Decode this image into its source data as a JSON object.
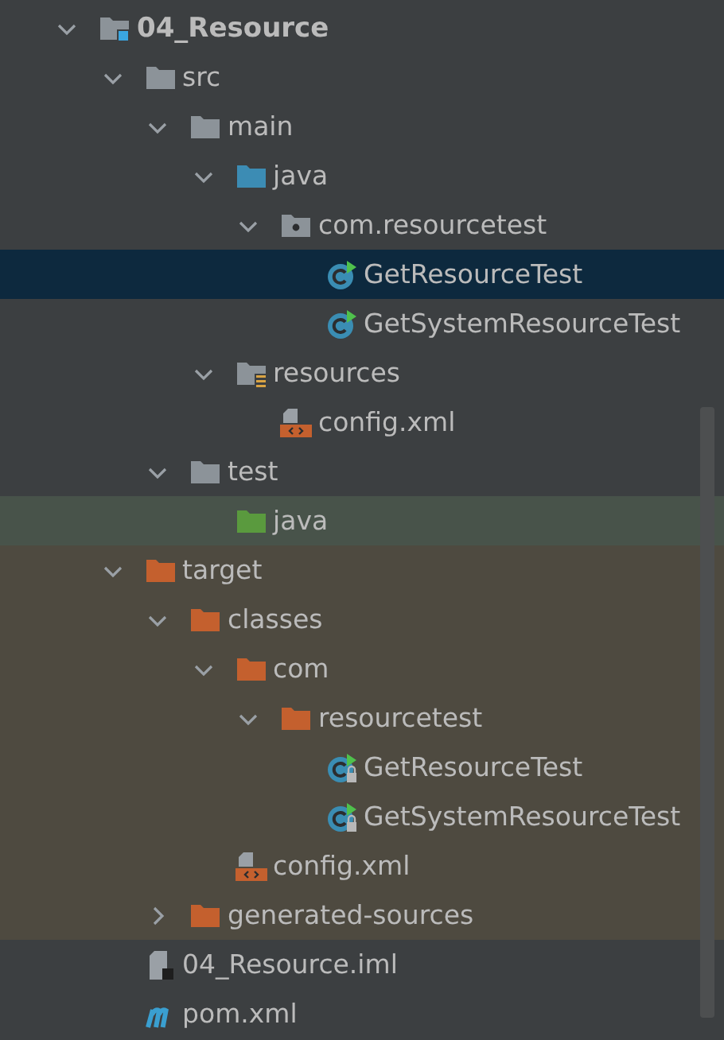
{
  "project_tree": [
    {
      "name": "04_Resource",
      "kind": "module",
      "expanded": true,
      "selected": false,
      "children": [
        {
          "name": "src",
          "kind": "folder",
          "expanded": true,
          "selected": false,
          "children": [
            {
              "name": "main",
              "kind": "folder",
              "expanded": true,
              "selected": false,
              "children": [
                {
                  "name": "java",
                  "kind": "source-folder",
                  "expanded": true,
                  "selected": false,
                  "children": [
                    {
                      "name": "com.resourcetest",
                      "kind": "package",
                      "expanded": true,
                      "selected": false,
                      "children": [
                        {
                          "name": "GetResourceTest",
                          "kind": "class",
                          "readonly": false,
                          "selected": true
                        },
                        {
                          "name": "GetSystemResourceTest",
                          "kind": "class",
                          "readonly": false,
                          "selected": false
                        }
                      ]
                    }
                  ]
                },
                {
                  "name": "resources",
                  "kind": "resources",
                  "expanded": true,
                  "selected": false,
                  "children": [
                    {
                      "name": "config.xml",
                      "kind": "xml",
                      "selected": false
                    }
                  ]
                }
              ]
            },
            {
              "name": "test",
              "kind": "folder",
              "expanded": true,
              "selected": false,
              "children": [
                {
                  "name": "java",
                  "kind": "test-folder",
                  "selected": false
                }
              ]
            }
          ]
        },
        {
          "name": "target",
          "kind": "excluded-folder",
          "expanded": true,
          "selected": false,
          "children": [
            {
              "name": "classes",
              "kind": "excluded-folder",
              "expanded": true,
              "selected": false,
              "children": [
                {
                  "name": "com",
                  "kind": "excluded-folder",
                  "expanded": true,
                  "selected": false,
                  "children": [
                    {
                      "name": "resourcetest",
                      "kind": "excluded-folder",
                      "expanded": true,
                      "selected": false,
                      "children": [
                        {
                          "name": "GetResourceTest",
                          "kind": "class",
                          "readonly": true,
                          "selected": false
                        },
                        {
                          "name": "GetSystemResourceTest",
                          "kind": "class",
                          "readonly": true,
                          "selected": false
                        }
                      ]
                    }
                  ]
                },
                {
                  "name": "config.xml",
                  "kind": "xml",
                  "selected": false
                }
              ]
            },
            {
              "name": "generated-sources",
              "kind": "excluded-folder",
              "expanded": false,
              "selected": false
            }
          ]
        },
        {
          "name": "04_Resource.iml",
          "kind": "iml",
          "selected": false
        },
        {
          "name": "pom.xml",
          "kind": "maven",
          "selected": false
        }
      ]
    }
  ]
}
